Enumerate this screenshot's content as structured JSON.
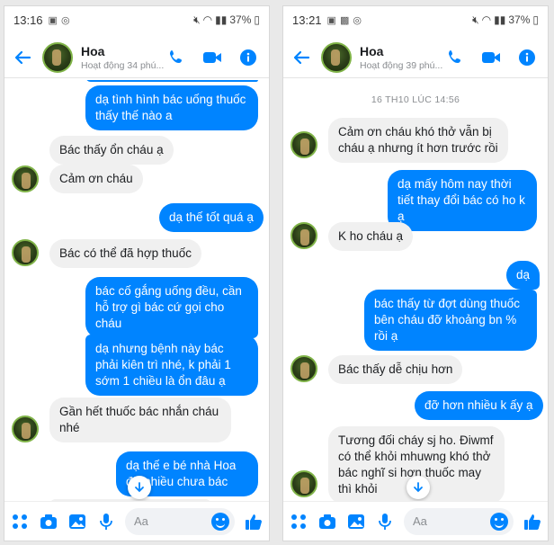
{
  "screens": [
    {
      "status": {
        "time": "13:16",
        "battery": "37%"
      },
      "contact": {
        "name": "Hoa",
        "status": "Hoạt động 34 phú..."
      },
      "timestamp": "",
      "composer_placeholder": "Aa",
      "messages": [
        {
          "side": "out",
          "text": "dạ tình hình bác uống thuốc thấy thế nào a"
        },
        {
          "side": "in",
          "text": "Bác thấy ổn cháu ạ"
        },
        {
          "side": "in",
          "text": "Cảm ơn cháu"
        },
        {
          "side": "out",
          "text": "dạ thế tốt quá ạ"
        },
        {
          "side": "in",
          "text": "Bác có thể đã hợp thuốc"
        },
        {
          "side": "out",
          "text": "bác cố gắng uống đều, cần hỗ trợ gì bác cứ gọi cho cháu"
        },
        {
          "side": "out",
          "text": "dạ nhưng bệnh này bác phải kiên trì nhé, k phải 1 sớm 1 chiều là ổn đâu ạ"
        },
        {
          "side": "in",
          "text": "Gần hết thuốc bác nhắn cháu nhé"
        },
        {
          "side": "out",
          "text": "dạ thế e bé nhà Hoa đỡ nhiều chưa bác"
        }
      ]
    },
    {
      "status": {
        "time": "13:21",
        "battery": "37%"
      },
      "contact": {
        "name": "Hoa",
        "status": "Hoạt động 39 phú..."
      },
      "timestamp": "16 TH10 LÚC 14:56",
      "composer_placeholder": "Aa",
      "messages": [
        {
          "side": "in",
          "text": "Cảm ơn cháu khó thở vẫn bị cháu ạ nhưng ít hơn trước rồi"
        },
        {
          "side": "out",
          "text": "dạ mấy hôm nay thời tiết thay đổi bác có ho k ạ"
        },
        {
          "side": "in",
          "text": "K ho cháu ạ"
        },
        {
          "side": "out",
          "text": "dạ"
        },
        {
          "side": "out",
          "text": "bác thấy từ đợt dùng thuốc bên cháu đỡ khoảng bn % rồi ạ"
        },
        {
          "side": "in",
          "text": "Bác thấy dễ chịu hơn"
        },
        {
          "side": "out",
          "text": "đỡ hơn nhiều k ấy ạ"
        },
        {
          "side": "in",
          "text": "Tương đối cháy sj ho. Điwmf có thể khỏi mhuwng khó thở bác nghĩ si hơn thuốc may thì khỏi"
        }
      ]
    }
  ],
  "colors": {
    "accent": "#0084ff",
    "incoming_bubble": "#f0f0f0"
  },
  "icons": [
    "back-arrow-icon",
    "phone-icon",
    "video-camera-icon",
    "info-icon",
    "apps-icon",
    "camera-icon",
    "gallery-icon",
    "microphone-icon",
    "emoji-icon",
    "thumbs-up-icon",
    "chevron-down-icon"
  ]
}
